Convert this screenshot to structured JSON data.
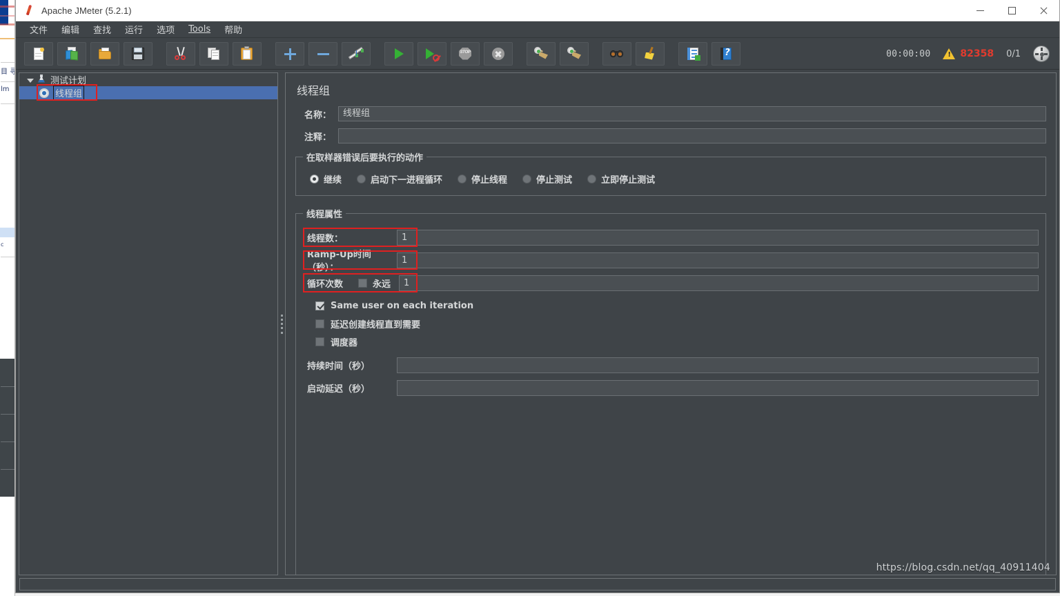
{
  "window": {
    "title": "Apache JMeter (5.2.1)",
    "minimize_label": "—",
    "maximize_label": "□",
    "close_label": "×"
  },
  "menubar": {
    "items": [
      {
        "label": "文件",
        "name": "menu-file"
      },
      {
        "label": "编辑",
        "name": "menu-edit"
      },
      {
        "label": "查找",
        "name": "menu-search"
      },
      {
        "label": "运行",
        "name": "menu-run"
      },
      {
        "label": "选项",
        "name": "menu-options"
      },
      {
        "label": "Tools",
        "name": "menu-tools",
        "mnemonic": "T"
      },
      {
        "label": "帮助",
        "name": "menu-help"
      }
    ]
  },
  "toolbar": {
    "icons": [
      {
        "name": "new-icon",
        "title": "新建"
      },
      {
        "name": "templates-icon",
        "title": "模板"
      },
      {
        "name": "open-icon",
        "title": "打开"
      },
      {
        "name": "save-icon",
        "title": "保存"
      },
      {
        "name": "cut-icon",
        "title": "剪切"
      },
      {
        "name": "copy-icon",
        "title": "复制"
      },
      {
        "name": "paste-icon",
        "title": "粘贴"
      },
      {
        "name": "expand-add-icon",
        "title": "展开全部"
      },
      {
        "name": "collapse-remove-icon",
        "title": "折叠全部"
      },
      {
        "name": "toggle-icon",
        "title": "切换"
      },
      {
        "name": "start-icon",
        "title": "启动"
      },
      {
        "name": "start-no-pauses-icon",
        "title": "无间隔启动"
      },
      {
        "name": "stop-icon",
        "title": "停止"
      },
      {
        "name": "shutdown-icon",
        "title": "关闭"
      },
      {
        "name": "clear-icon",
        "title": "清除"
      },
      {
        "name": "clear-all-icon",
        "title": "清除全部"
      },
      {
        "name": "find-icon",
        "title": "查找"
      },
      {
        "name": "reset-search-icon",
        "title": "重置查找"
      },
      {
        "name": "function-helper-icon",
        "title": "函数助手对话框"
      },
      {
        "name": "help-icon",
        "title": "帮助"
      }
    ],
    "timer": "00:00:00",
    "warning_count": "82358",
    "threads_count": "0/1",
    "warning_color": "#e23b2e"
  },
  "tree": {
    "nodes": [
      {
        "label": "测试计划",
        "name": "tree-node-test-plan",
        "level": 1,
        "icon": "test-plan-icon",
        "expanded": true,
        "selected": false
      },
      {
        "label": "线程组",
        "name": "tree-node-thread-group",
        "level": 2,
        "icon": "thread-group-icon",
        "expanded": false,
        "selected": true,
        "editing": true
      }
    ]
  },
  "main": {
    "title": "线程组",
    "name_label": "名称：",
    "name_value": "线程组",
    "comment_label": "注释：",
    "comment_value": "",
    "error_action": {
      "legend": "在取样器错误后要执行的动作",
      "options": [
        {
          "label": "继续",
          "name": "radio-continue",
          "selected": true
        },
        {
          "label": "启动下一进程循环",
          "name": "radio-start-next-loop",
          "selected": false
        },
        {
          "label": "停止线程",
          "name": "radio-stop-thread",
          "selected": false
        },
        {
          "label": "停止测试",
          "name": "radio-stop-test",
          "selected": false
        },
        {
          "label": "立即停止测试",
          "name": "radio-stop-test-now",
          "selected": false
        }
      ]
    },
    "thread_properties": {
      "legend": "线程属性",
      "num_threads_label": "线程数：",
      "num_threads_value": "1",
      "ramp_up_label": "Ramp-Up时间（秒）：",
      "ramp_up_value": "1",
      "loop_count_label": "循环次数",
      "loop_forever_label": "永远",
      "loop_forever_checked": false,
      "loop_count_value": "1",
      "same_user_label": "Same user on each iteration",
      "same_user_checked": true,
      "delay_create_label": "延迟创建线程直到需要",
      "delay_create_checked": false,
      "scheduler_label": "调度器",
      "scheduler_checked": false,
      "duration_label": "持续时间（秒）",
      "duration_value": "",
      "startup_delay_label": "启动延迟（秒）",
      "startup_delay_value": ""
    }
  },
  "annotations": {
    "highlight_color": "#e02020",
    "boxes": [
      "tree-thread-group",
      "num-threads-row",
      "ramp-up-row",
      "loop-count-row"
    ]
  },
  "watermark": "https://blog.csdn.net/qq_40911404"
}
